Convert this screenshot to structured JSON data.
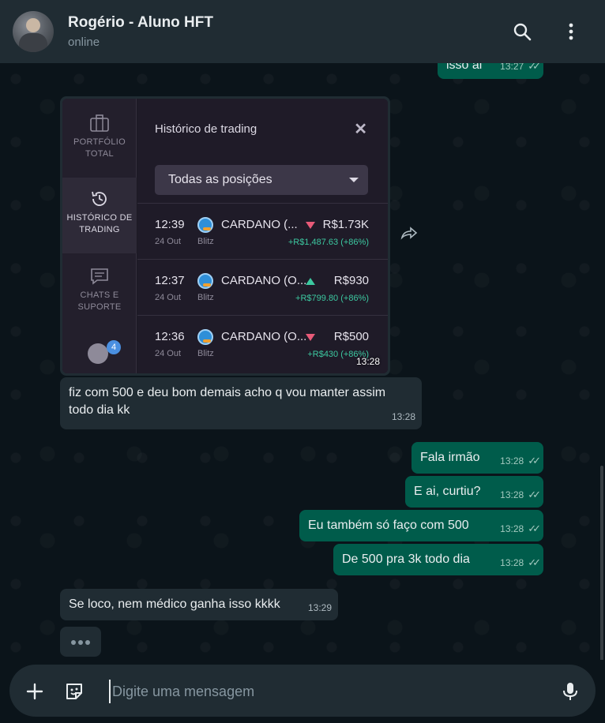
{
  "header": {
    "contact_name": "Rogério - Aluno HFT",
    "status": "online"
  },
  "messages": {
    "top_out": {
      "text": "isso ai",
      "time": "13:27"
    },
    "image": {
      "time": "13:28",
      "sidebar": [
        {
          "label": "PORTFÓLIO TOTAL"
        },
        {
          "label": "HISTÓRICO DE TRADING"
        },
        {
          "label": "CHATS E SUPORTE"
        }
      ],
      "badge": "4",
      "title": "Histórico de trading",
      "filter": "Todas as posições",
      "trades": [
        {
          "time": "12:39",
          "date": "24 Out",
          "name": "CARDANO (...",
          "type": "Blitz",
          "direction": "down",
          "amount": "R$1.73K",
          "profit": "+R$1,487.63 (+86%)"
        },
        {
          "time": "12:37",
          "date": "24 Out",
          "name": "CARDANO (O...",
          "type": "Blitz",
          "direction": "up",
          "amount": "R$930",
          "profit": "+R$799.80 (+86%)"
        },
        {
          "time": "12:36",
          "date": "24 Out",
          "name": "CARDANO (O...",
          "type": "Blitz",
          "direction": "down",
          "amount": "R$500",
          "profit": "+R$430 (+86%)"
        }
      ]
    },
    "in1": {
      "text": "fiz com 500 e deu bom demais acho q vou manter assim todo dia kk",
      "time": "13:28"
    },
    "out1": {
      "text": "Fala irmão",
      "time": "13:28"
    },
    "out2": {
      "text": "E ai, curtiu?",
      "time": "13:28"
    },
    "out3": {
      "text": "Eu também só faço com 500",
      "time": "13:28"
    },
    "out4": {
      "text": "De 500 pra 3k todo dia",
      "time": "13:28"
    },
    "in2": {
      "text": "Se loco, nem médico ganha isso kkkk",
      "time": "13:29"
    }
  },
  "footer": {
    "placeholder": "Digite uma mensagem"
  },
  "colors": {
    "header_bg": "#202c33",
    "incoming_bubble": "#202c33",
    "outgoing_bubble": "#005c4b",
    "profit_green": "#3cc8a0",
    "down_red": "#e85a78"
  }
}
